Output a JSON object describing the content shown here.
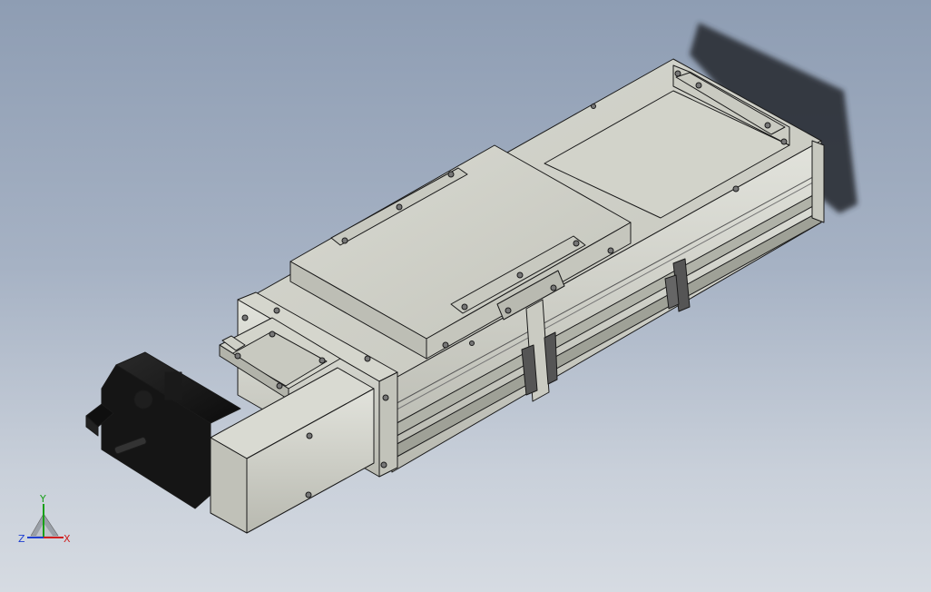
{
  "viewport": {
    "background_top": "#8e9db3",
    "background_bottom": "#d6dbe2"
  },
  "model": {
    "part_color": "#cfd0c7",
    "part_shade": "#a9aba0",
    "edge_color": "#1a1a1a",
    "motor_color": "#151515",
    "shadow_color": "#2b2f35"
  },
  "triad": {
    "x_label": "X",
    "y_label": "Y",
    "z_label": "Z",
    "x_color": "#d02020",
    "y_color": "#18a018",
    "z_color": "#2040d0"
  }
}
